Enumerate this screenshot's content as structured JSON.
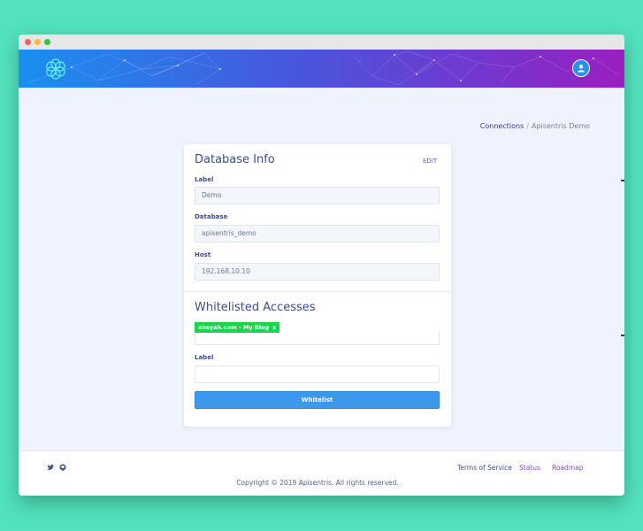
{
  "header": {
    "logo_icon": "flower-logo-icon",
    "avatar_icon": "user-icon"
  },
  "breadcrumb": {
    "parent": "Connections",
    "separator": "/",
    "current": "Apisentris Demo"
  },
  "database_info": {
    "title": "Database Info",
    "edit_label": "EDIT",
    "fields": [
      {
        "label": "Label",
        "value": "Demo"
      },
      {
        "label": "Database",
        "value": "apisentris_demo"
      },
      {
        "label": "Host",
        "value": "192.168.10.10"
      }
    ]
  },
  "whitelist": {
    "title": "Whitelisted Accesses",
    "tag_label": "absyah.com - My Blog",
    "tag_remove": "x",
    "label_field": {
      "label": "Label",
      "value": ""
    },
    "submit_label": "Whitelist"
  },
  "footer": {
    "social_icons": [
      "twitter-icon",
      "github-icon"
    ],
    "links": [
      "Terms of Service",
      "Status",
      "Roadmap"
    ],
    "copyright": "Copyright © 2019 Apisentris. All rights reserved."
  }
}
